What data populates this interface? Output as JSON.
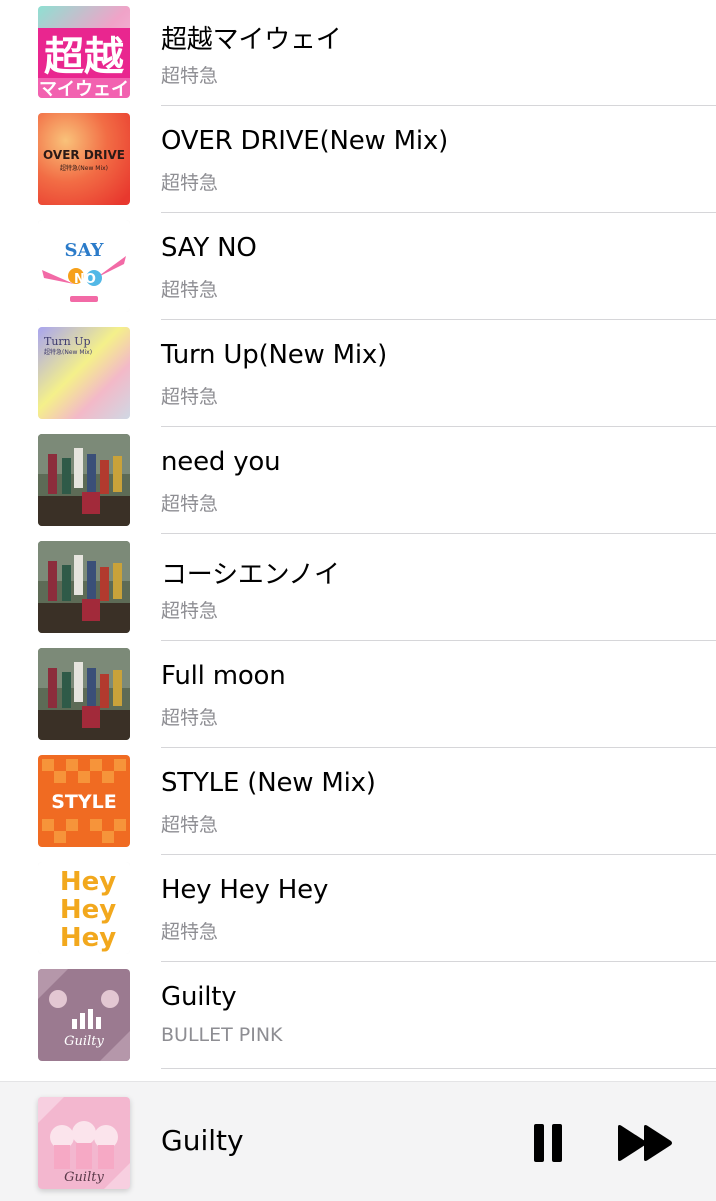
{
  "songs": [
    {
      "title": "超越マイウェイ",
      "artist": "超特急",
      "artwork_icon": "album-art-chouetsu-my-way",
      "artwork_text": [
        "超越",
        "マイウェイ"
      ]
    },
    {
      "title": "OVER DRIVE(New Mix)",
      "artist": "超特急",
      "artwork_icon": "album-art-over-drive",
      "artwork_text": [
        "OVER DRIVE",
        "超特急(New Mix)"
      ]
    },
    {
      "title": "SAY NO",
      "artist": "超特急",
      "artwork_icon": "album-art-say-no",
      "artwork_text": [
        "SAY",
        "NO"
      ]
    },
    {
      "title": "Turn Up(New Mix)",
      "artist": "超特急",
      "artwork_icon": "album-art-turn-up",
      "artwork_text": [
        "Turn Up",
        "超特急(New Mix)"
      ]
    },
    {
      "title": "need you",
      "artist": "超特急",
      "artwork_icon": "album-art-group-photo",
      "artwork_text": []
    },
    {
      "title": "コーシエンノイ",
      "artist": "超特急",
      "artwork_icon": "album-art-group-photo",
      "artwork_text": []
    },
    {
      "title": "Full moon",
      "artist": "超特急",
      "artwork_icon": "album-art-group-photo",
      "artwork_text": []
    },
    {
      "title": "STYLE (New Mix)",
      "artist": "超特急",
      "artwork_icon": "album-art-style",
      "artwork_text": [
        "STYLE"
      ]
    },
    {
      "title": "Hey Hey Hey",
      "artist": "超特急",
      "artwork_icon": "album-art-hey-hey-hey",
      "artwork_text": [
        "Hey",
        "Hey",
        "Hey"
      ]
    },
    {
      "title": "Guilty",
      "artist": "BULLET PINK",
      "artwork_icon": "album-art-guilty",
      "artwork_text": [
        "Guilty"
      ]
    }
  ],
  "now_playing": {
    "title": "Guilty",
    "artwork_icon": "album-art-guilty",
    "artwork_text": [
      "Guilty"
    ],
    "pause_icon": "pause-icon",
    "forward_icon": "fast-forward-icon"
  },
  "colors": {
    "separator": "#d6d6d9",
    "secondary_text": "#8e8e93",
    "player_background": "#f4f4f5",
    "controls": "#000000"
  }
}
